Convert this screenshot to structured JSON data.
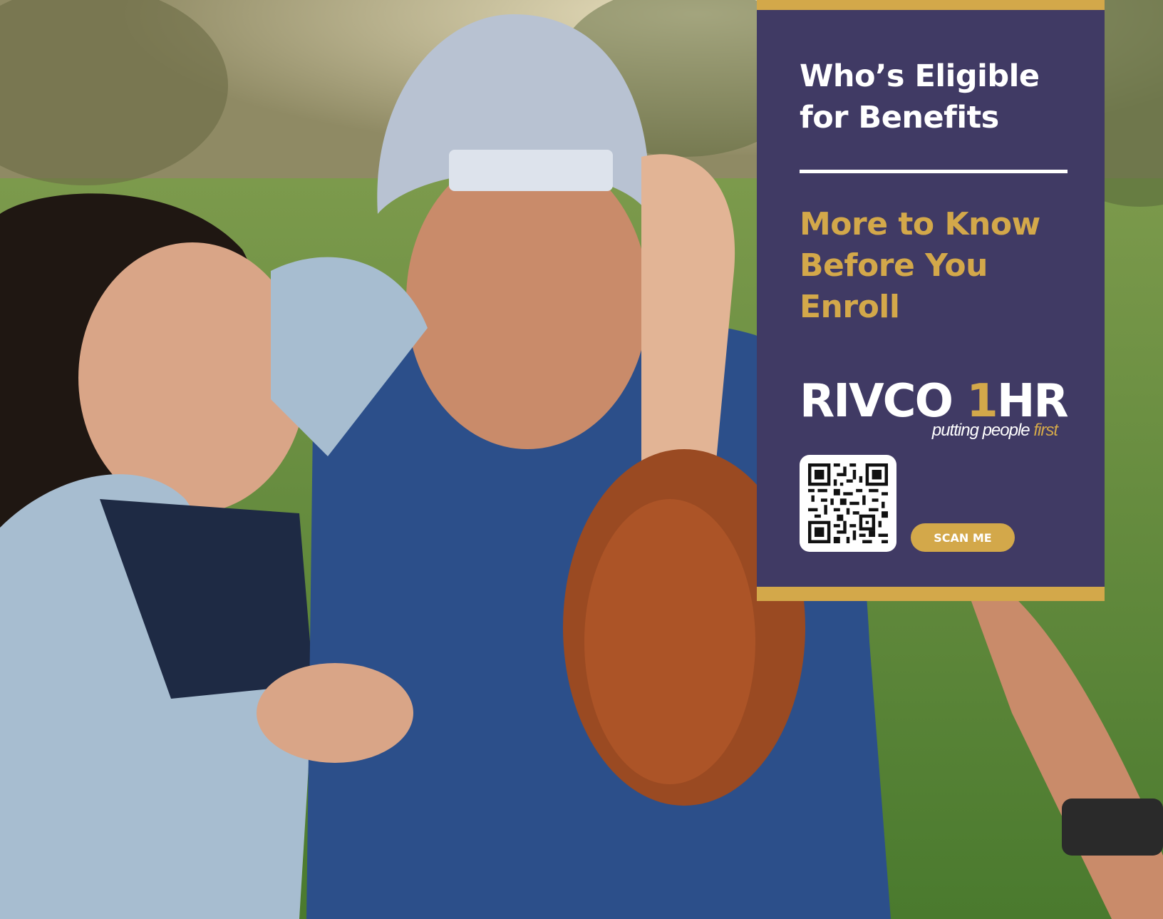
{
  "colors": {
    "panel_bg": "#403a64",
    "gold": "#d3a84a",
    "white": "#ffffff"
  },
  "photo": {
    "alt": ""
  },
  "panel": {
    "title": "Who’s Eligible for Benefits",
    "subtitle": "More to Know Before You Enroll",
    "logo": {
      "main_before": "RIVCO ",
      "main_accent": "1",
      "main_after": "HR",
      "tagline_plain": "putting people ",
      "tagline_accent": "first"
    },
    "qr_icon": "qr-code-icon",
    "scan_label": "SCAN ME"
  }
}
